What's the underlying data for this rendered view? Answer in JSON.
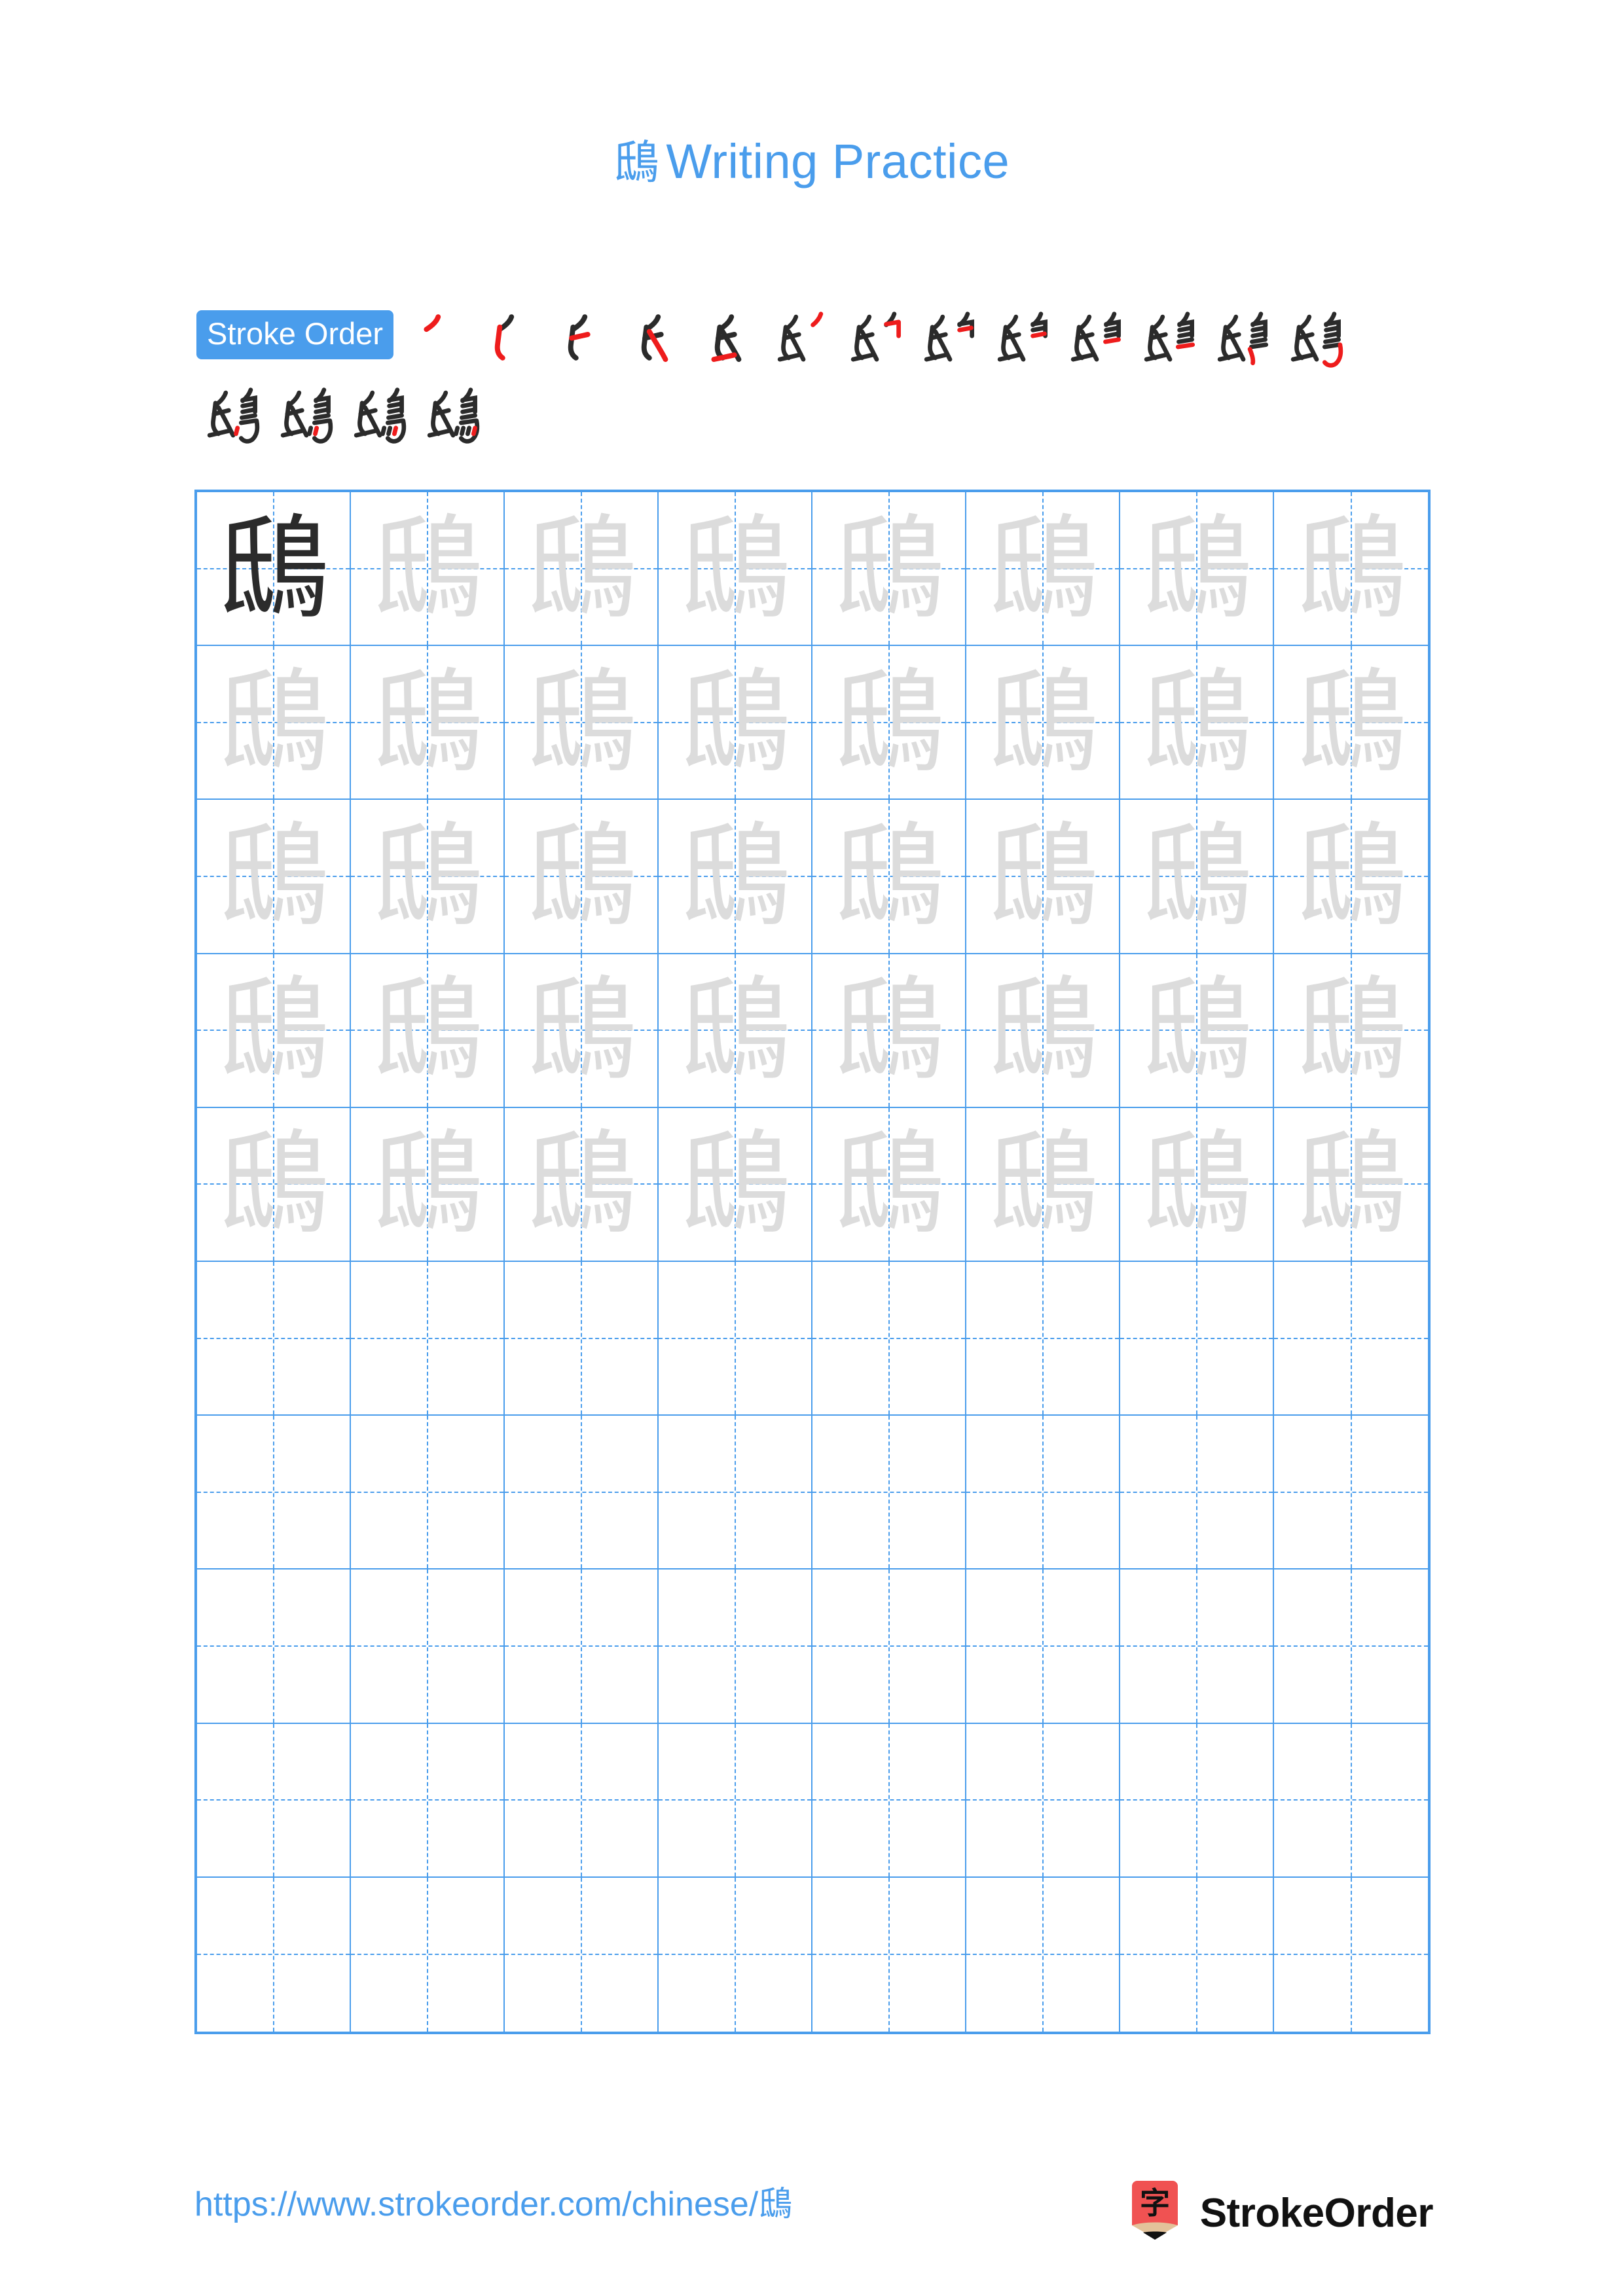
{
  "page": {
    "character": "鴟",
    "title_suffix": "Writing Practice",
    "background_color": "#ffffff",
    "accent_color": "#4a9dec",
    "trace_color": "#dcdcdc",
    "model_color": "#2b2b2b",
    "stroke_highlight_color": "#ee1c1c"
  },
  "stroke_order": {
    "badge_label": "Stroke Order",
    "total_strokes": 17,
    "row1_count": 13,
    "row2_count": 4,
    "partials_row1": [
      "㇓",
      "⺁",
      "𠄐",
      "氏",
      "氏",
      "氏",
      "氏",
      "氏",
      "氏",
      "氏",
      "氏",
      "鴟",
      "鴟"
    ],
    "partials_row2": [
      "鴟",
      "鴟",
      "鴟",
      "鴟"
    ]
  },
  "grid": {
    "columns": 8,
    "rows": 10,
    "filled_rows": 5,
    "model_cell_index": 0,
    "cell_character": "鴟",
    "border_color": "#4a9dec",
    "guide_line_style": "dashed"
  },
  "footer": {
    "url": "https://www.strokeorder.com/chinese/鴟",
    "brand_name": "StrokeOrder",
    "logo_character": "字",
    "logo_body_color": "#f05252",
    "logo_wood_color": "#e3c29a",
    "logo_tip_color": "#111111"
  }
}
